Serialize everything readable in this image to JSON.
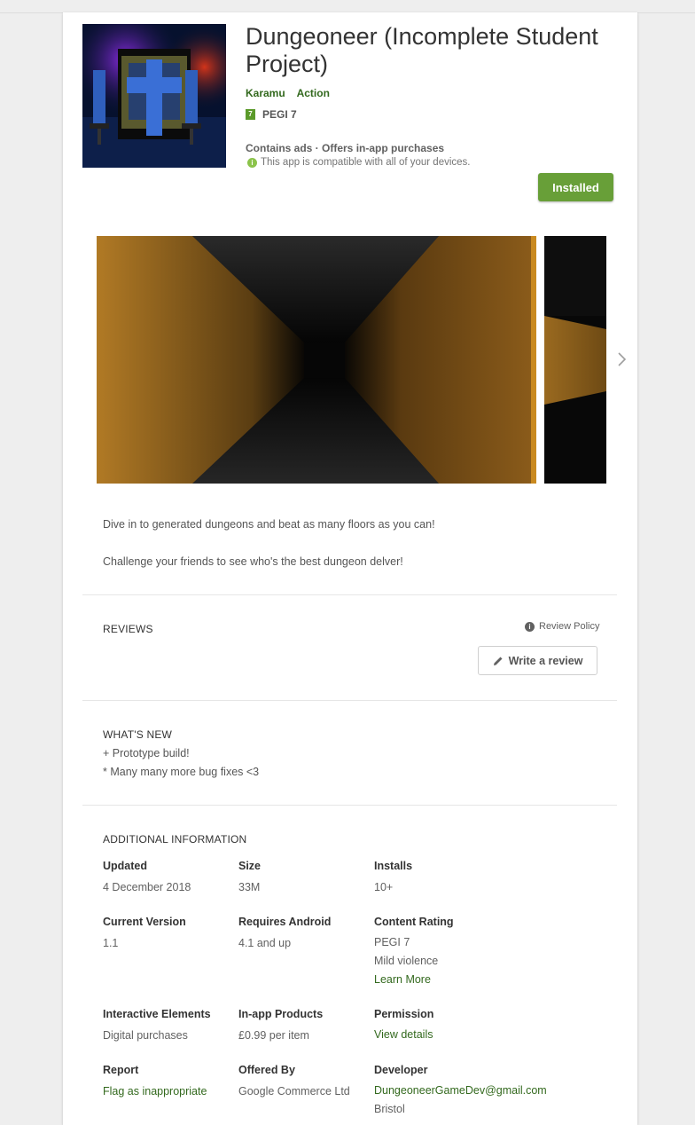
{
  "app": {
    "title": "Dungeoneer (Incomplete Student Project)",
    "developer": "Karamu",
    "category": "Action",
    "rating_badge": "7",
    "rating": "PEGI 7",
    "ads_notice": "Contains ads · Offers in-app purchases",
    "compat_notice": "This app is compatible with all of your devices.",
    "install_button": "Installed"
  },
  "description": {
    "line1": "Dive in to generated dungeons and beat as many floors as you can!",
    "line2": "Challenge your friends to see who's the best dungeon delver!"
  },
  "reviews": {
    "title": "REVIEWS",
    "policy": "Review Policy",
    "write_button": "Write a review"
  },
  "whats_new": {
    "title": "WHAT'S NEW",
    "line1": "+ Prototype build!",
    "line2": "* Many many more bug fixes <3"
  },
  "info": {
    "title": "ADDITIONAL INFORMATION",
    "updated_label": "Updated",
    "updated_value": "4 December 2018",
    "size_label": "Size",
    "size_value": "33M",
    "installs_label": "Installs",
    "installs_value": "10+",
    "version_label": "Current Version",
    "version_value": "1.1",
    "android_label": "Requires Android",
    "android_value": "4.1 and up",
    "content_label": "Content Rating",
    "content_value": "PEGI 7",
    "content_detail": "Mild violence",
    "content_link": "Learn More",
    "interactive_label": "Interactive Elements",
    "interactive_value": "Digital purchases",
    "iap_label": "In-app Products",
    "iap_value": "£0.99 per item",
    "permission_label": "Permission",
    "permission_link": "View details",
    "report_label": "Report",
    "report_link": "Flag as inappropriate",
    "offered_label": "Offered By",
    "offered_value": "Google Commerce Ltd",
    "dev_label": "Developer",
    "dev_email": "DungeoneerGameDev@gmail.com",
    "dev_city": "Bristol"
  },
  "colors": {
    "accent_green": "#689f38",
    "link_green": "#33691e"
  }
}
